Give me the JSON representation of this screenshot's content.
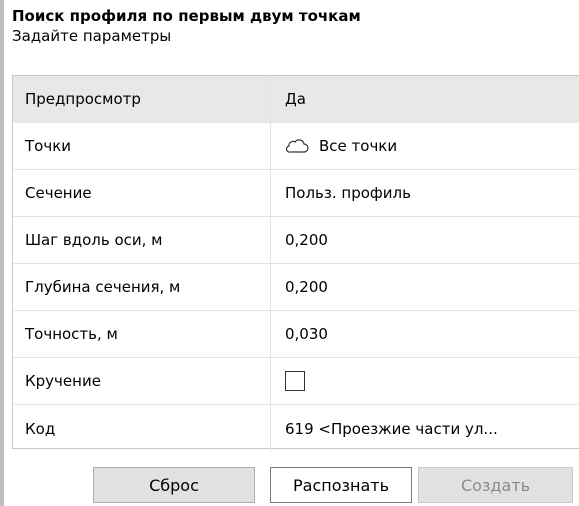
{
  "header": {
    "title": "Поиск профиля по первым двум точкам",
    "subtitle": "Задайте параметры"
  },
  "properties": [
    {
      "name": "Предпросмотр",
      "value": "Да"
    },
    {
      "name": "Точки",
      "value": "Все точки",
      "icon": "cloud-icon"
    },
    {
      "name": "Сечение",
      "value": "Польз. профиль"
    },
    {
      "name": "Шаг вдоль оси, м",
      "value": "0,200"
    },
    {
      "name": "Глубина сечения, м",
      "value": "0,200"
    },
    {
      "name": "Точность, м",
      "value": "0,030"
    },
    {
      "name": "Кручение",
      "value": "",
      "checkbox_checked": false
    },
    {
      "name": "Код",
      "value": "619 <Проезжие части ул..."
    }
  ],
  "buttons": {
    "reset": "Сброс",
    "recognize": "Распознать",
    "create": "Создать"
  }
}
